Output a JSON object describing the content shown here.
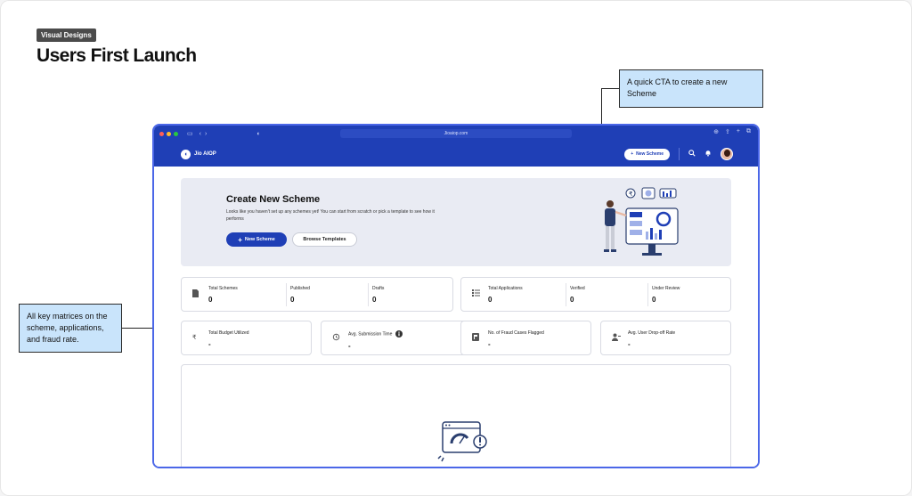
{
  "header": {
    "tag": "Visual Designs",
    "title": "Users First Launch"
  },
  "annotations": {
    "cta_note": "A quick CTA to create a new Scheme",
    "metrics_note": "All key matrices on the scheme, applications, and fraud rate."
  },
  "browser": {
    "url": "Jioaiop.com"
  },
  "app": {
    "logo_glyph": "◖",
    "name": "Jio AIOP",
    "new_scheme_button": "New Scheme",
    "icons": {
      "search": "search-icon",
      "bell": "bell-icon",
      "avatar": "avatar"
    }
  },
  "hero": {
    "title": "Create New Scheme",
    "description": "Looks like you haven't set up any schemes yet! You can start from scratch or pick a template to see how it performs",
    "primary_button": "New Scheme",
    "secondary_button": "Browse Templates"
  },
  "stats": {
    "schemes": [
      {
        "label": "Total Schemes",
        "value": "0"
      },
      {
        "label": "Published",
        "value": "0"
      },
      {
        "label": "Drafts",
        "value": "0"
      }
    ],
    "applications": [
      {
        "label": "Total Applications",
        "value": "0"
      },
      {
        "label": "Verified",
        "value": "0"
      },
      {
        "label": "Under Review",
        "value": "0"
      }
    ],
    "budget": {
      "label": "Total Budget Utilized",
      "value": "-",
      "icon": "₹"
    },
    "submission": {
      "label": "Avg. Submission Time",
      "value": "-"
    },
    "fraud": {
      "label": "No. of Fraud Cases Flagged",
      "value": "-"
    },
    "dropoff": {
      "label": "Avg. User Drop-off Rate",
      "value": "-"
    }
  },
  "colors": {
    "primary": "#1f3fb6",
    "note_fill": "#c9e4fb",
    "frame": "#4b67e8"
  }
}
